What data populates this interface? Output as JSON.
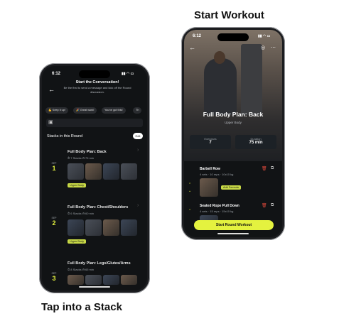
{
  "captions": {
    "right": "Start Workout",
    "left": "Tap into a Stack"
  },
  "left_screen": {
    "status_time": "6:12",
    "header": {
      "title": "Start the Conversation!",
      "subtitle": "Be the first to send a message and kick off the Round discussion."
    },
    "quick_replies": [
      "💪 Keep it up!",
      "🎉 Great work!",
      "You've got this!",
      "Th"
    ],
    "section_title": "Stacks in this Round",
    "edit_label": "Edit",
    "stacks": [
      {
        "month": "SEP",
        "day": "1",
        "title": "Full Body Plan: Back",
        "meta1": "7 Stacks",
        "meta2": "75 min",
        "tag": "Upper Body"
      },
      {
        "month": "SEP",
        "day": "2",
        "title": "Full Body Plan: Chest/Shoulders",
        "meta1": "6 Stacks",
        "meta2": "60 min",
        "tag": "Upper Body"
      },
      {
        "month": "SEP",
        "day": "3",
        "title": "Full Body Plan: Legs/Glutes/Arms",
        "meta1": "8 Stacks",
        "meta2": "65 min",
        "tag": ""
      }
    ]
  },
  "right_screen": {
    "status_time": "6:12",
    "plan_title": "Full Body Plan: Back",
    "plan_subtitle": "Upper Body",
    "stats": [
      {
        "label": "Exercises",
        "value": "7"
      },
      {
        "label": "Duration",
        "value": "75 min"
      }
    ],
    "exercises": [
      {
        "name": "Barbell Row",
        "meta": "4 sets · 10 reps · 10x10 kg",
        "action": "Add Formula"
      },
      {
        "name": "Seated Rope Pull Down",
        "meta": "4 sets · 15 reps · 15x10 kg"
      }
    ],
    "cta_label": "Start Round Workout"
  },
  "colors": {
    "accent": "#e4f23f",
    "background": "#111315",
    "danger": "#e04a3c"
  }
}
